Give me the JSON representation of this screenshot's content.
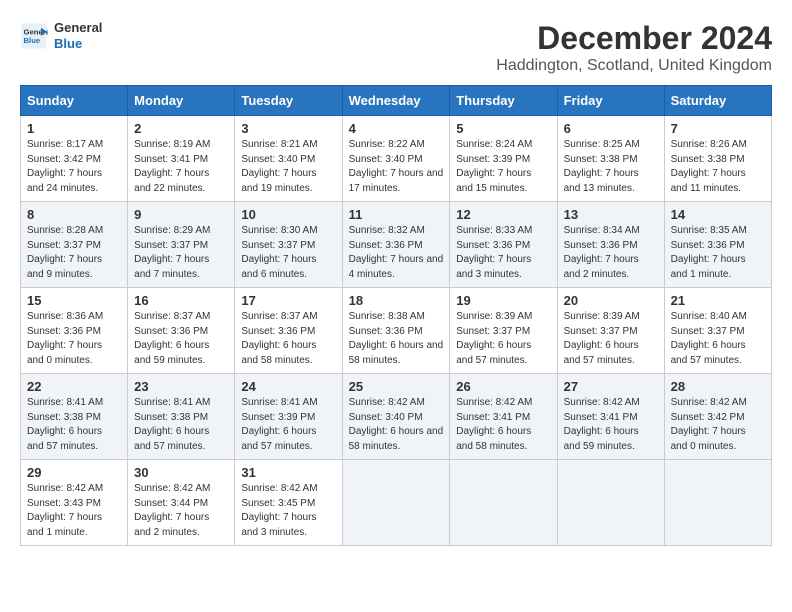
{
  "logo": {
    "line1": "General",
    "line2": "Blue"
  },
  "title": "December 2024",
  "subtitle": "Haddington, Scotland, United Kingdom",
  "days_of_week": [
    "Sunday",
    "Monday",
    "Tuesday",
    "Wednesday",
    "Thursday",
    "Friday",
    "Saturday"
  ],
  "weeks": [
    [
      {
        "day": 1,
        "sunrise": "8:17 AM",
        "sunset": "3:42 PM",
        "daylight": "7 hours and 24 minutes."
      },
      {
        "day": 2,
        "sunrise": "8:19 AM",
        "sunset": "3:41 PM",
        "daylight": "7 hours and 22 minutes."
      },
      {
        "day": 3,
        "sunrise": "8:21 AM",
        "sunset": "3:40 PM",
        "daylight": "7 hours and 19 minutes."
      },
      {
        "day": 4,
        "sunrise": "8:22 AM",
        "sunset": "3:40 PM",
        "daylight": "7 hours and 17 minutes."
      },
      {
        "day": 5,
        "sunrise": "8:24 AM",
        "sunset": "3:39 PM",
        "daylight": "7 hours and 15 minutes."
      },
      {
        "day": 6,
        "sunrise": "8:25 AM",
        "sunset": "3:38 PM",
        "daylight": "7 hours and 13 minutes."
      },
      {
        "day": 7,
        "sunrise": "8:26 AM",
        "sunset": "3:38 PM",
        "daylight": "7 hours and 11 minutes."
      }
    ],
    [
      {
        "day": 8,
        "sunrise": "8:28 AM",
        "sunset": "3:37 PM",
        "daylight": "7 hours and 9 minutes."
      },
      {
        "day": 9,
        "sunrise": "8:29 AM",
        "sunset": "3:37 PM",
        "daylight": "7 hours and 7 minutes."
      },
      {
        "day": 10,
        "sunrise": "8:30 AM",
        "sunset": "3:37 PM",
        "daylight": "7 hours and 6 minutes."
      },
      {
        "day": 11,
        "sunrise": "8:32 AM",
        "sunset": "3:36 PM",
        "daylight": "7 hours and 4 minutes."
      },
      {
        "day": 12,
        "sunrise": "8:33 AM",
        "sunset": "3:36 PM",
        "daylight": "7 hours and 3 minutes."
      },
      {
        "day": 13,
        "sunrise": "8:34 AM",
        "sunset": "3:36 PM",
        "daylight": "7 hours and 2 minutes."
      },
      {
        "day": 14,
        "sunrise": "8:35 AM",
        "sunset": "3:36 PM",
        "daylight": "7 hours and 1 minute."
      }
    ],
    [
      {
        "day": 15,
        "sunrise": "8:36 AM",
        "sunset": "3:36 PM",
        "daylight": "7 hours and 0 minutes."
      },
      {
        "day": 16,
        "sunrise": "8:37 AM",
        "sunset": "3:36 PM",
        "daylight": "6 hours and 59 minutes."
      },
      {
        "day": 17,
        "sunrise": "8:37 AM",
        "sunset": "3:36 PM",
        "daylight": "6 hours and 58 minutes."
      },
      {
        "day": 18,
        "sunrise": "8:38 AM",
        "sunset": "3:36 PM",
        "daylight": "6 hours and 58 minutes."
      },
      {
        "day": 19,
        "sunrise": "8:39 AM",
        "sunset": "3:37 PM",
        "daylight": "6 hours and 57 minutes."
      },
      {
        "day": 20,
        "sunrise": "8:39 AM",
        "sunset": "3:37 PM",
        "daylight": "6 hours and 57 minutes."
      },
      {
        "day": 21,
        "sunrise": "8:40 AM",
        "sunset": "3:37 PM",
        "daylight": "6 hours and 57 minutes."
      }
    ],
    [
      {
        "day": 22,
        "sunrise": "8:41 AM",
        "sunset": "3:38 PM",
        "daylight": "6 hours and 57 minutes."
      },
      {
        "day": 23,
        "sunrise": "8:41 AM",
        "sunset": "3:38 PM",
        "daylight": "6 hours and 57 minutes."
      },
      {
        "day": 24,
        "sunrise": "8:41 AM",
        "sunset": "3:39 PM",
        "daylight": "6 hours and 57 minutes."
      },
      {
        "day": 25,
        "sunrise": "8:42 AM",
        "sunset": "3:40 PM",
        "daylight": "6 hours and 58 minutes."
      },
      {
        "day": 26,
        "sunrise": "8:42 AM",
        "sunset": "3:41 PM",
        "daylight": "6 hours and 58 minutes."
      },
      {
        "day": 27,
        "sunrise": "8:42 AM",
        "sunset": "3:41 PM",
        "daylight": "6 hours and 59 minutes."
      },
      {
        "day": 28,
        "sunrise": "8:42 AM",
        "sunset": "3:42 PM",
        "daylight": "7 hours and 0 minutes."
      }
    ],
    [
      {
        "day": 29,
        "sunrise": "8:42 AM",
        "sunset": "3:43 PM",
        "daylight": "7 hours and 1 minute."
      },
      {
        "day": 30,
        "sunrise": "8:42 AM",
        "sunset": "3:44 PM",
        "daylight": "7 hours and 2 minutes."
      },
      {
        "day": 31,
        "sunrise": "8:42 AM",
        "sunset": "3:45 PM",
        "daylight": "7 hours and 3 minutes."
      },
      null,
      null,
      null,
      null
    ]
  ],
  "labels": {
    "sunrise": "Sunrise:",
    "sunset": "Sunset:",
    "daylight": "Daylight:"
  }
}
